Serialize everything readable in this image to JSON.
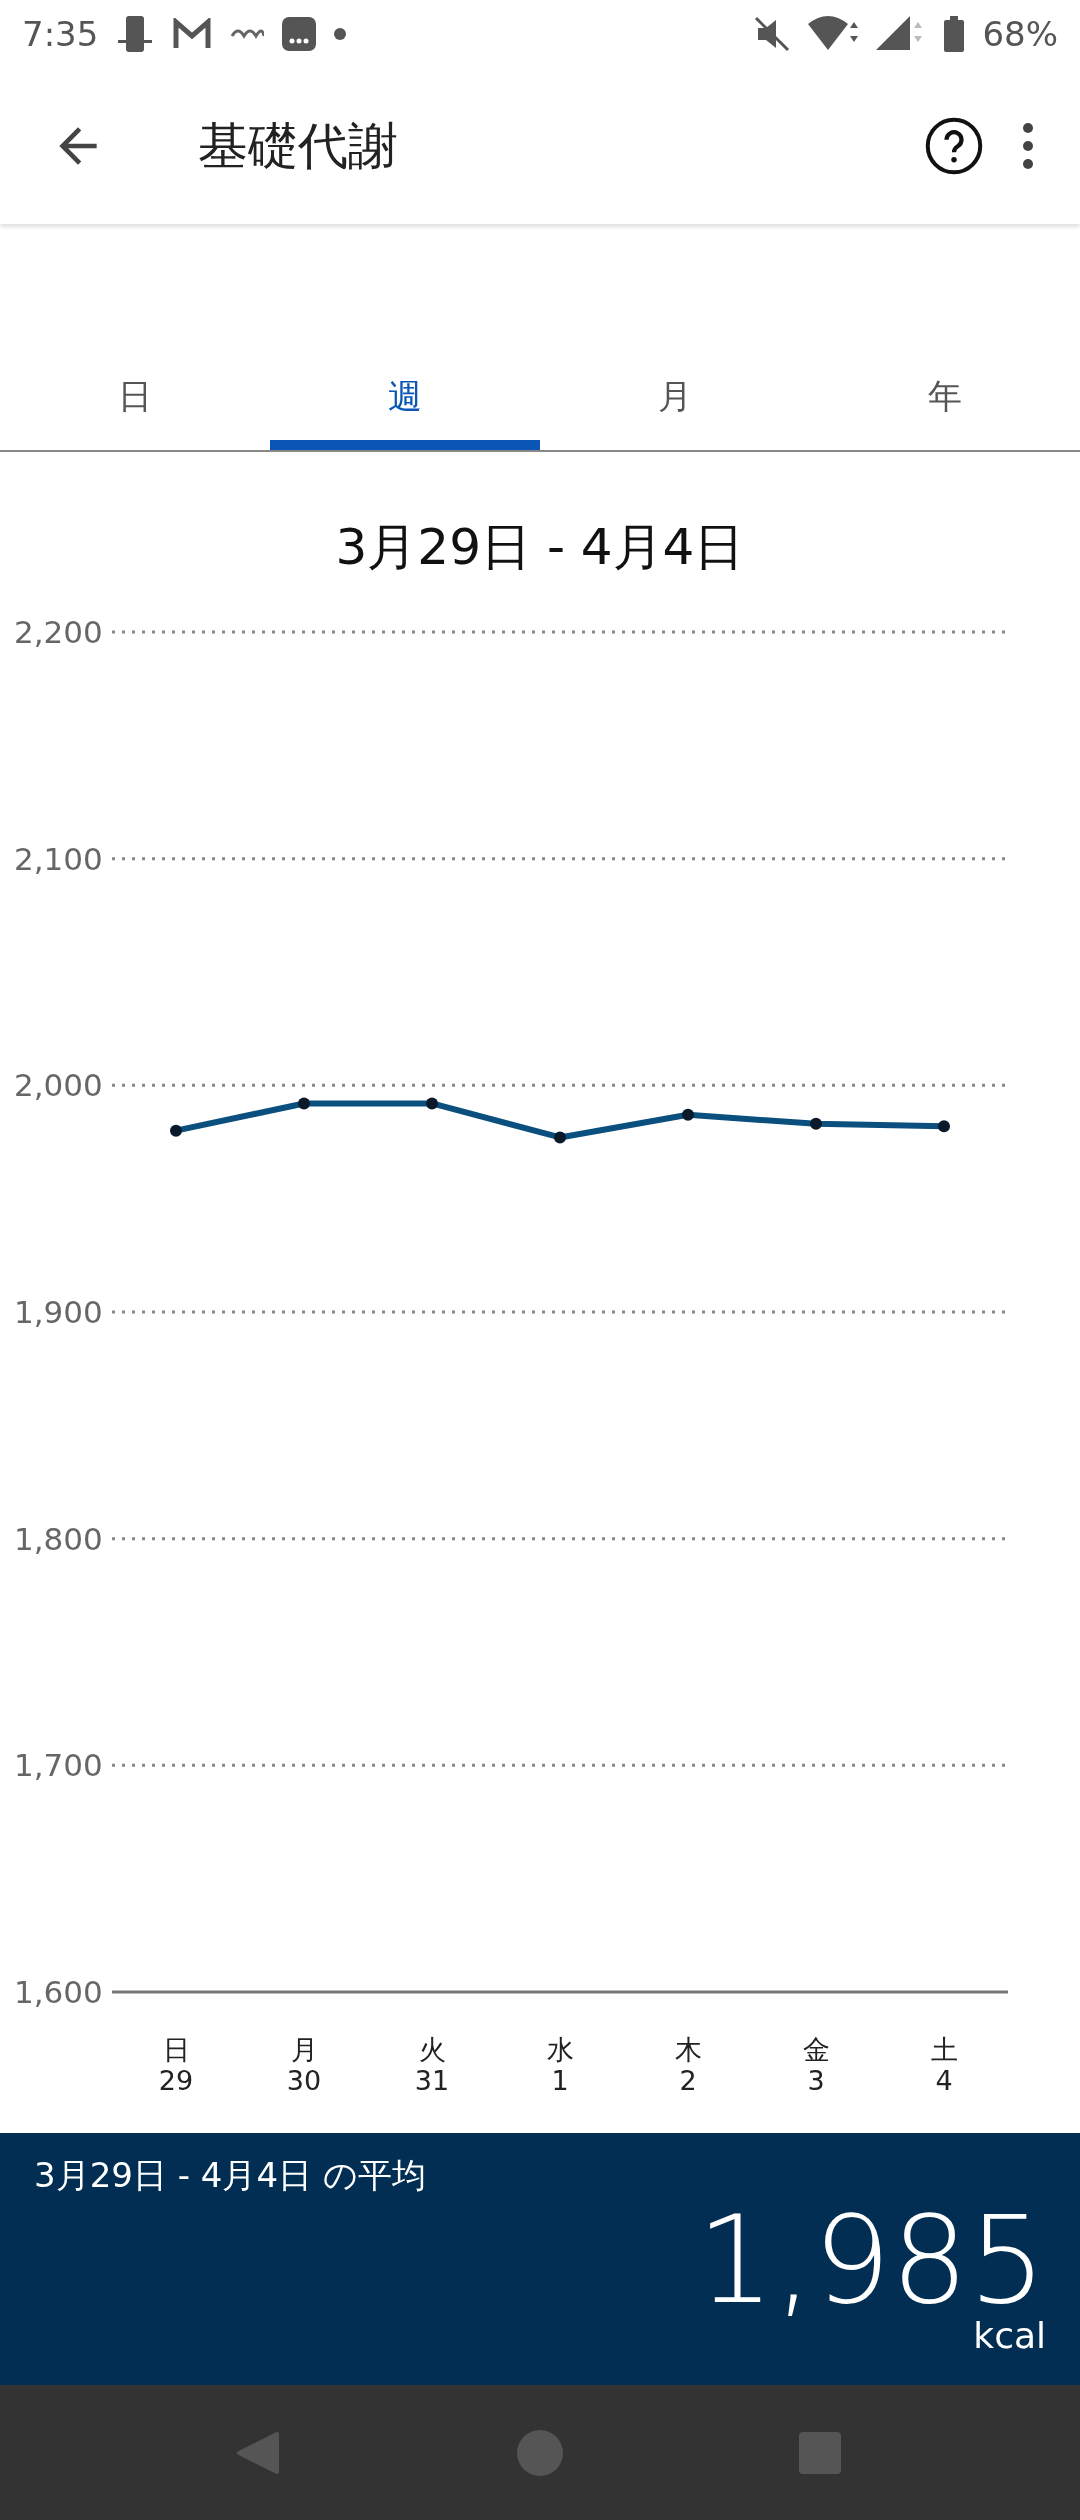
{
  "status_bar": {
    "time": "7:35",
    "battery": "68%"
  },
  "app_bar": {
    "title": "基礎代謝"
  },
  "tabs": [
    {
      "label": "日",
      "selected": false
    },
    {
      "label": "週",
      "selected": true
    },
    {
      "label": "月",
      "selected": false
    },
    {
      "label": "年",
      "selected": false
    }
  ],
  "period_title": "3月29日 - 4月4日",
  "chart_data": {
    "type": "line",
    "categories": [
      "日\n29",
      "月\n30",
      "火\n31",
      "水\n1",
      "木\n2",
      "金\n3",
      "土\n4"
    ],
    "series": [
      {
        "color": "#0a4f7e",
        "marker": true,
        "values": [
          1980,
          1992,
          1992,
          1977,
          1987,
          1983,
          1982
        ]
      }
    ],
    "grid": true,
    "ylim": [
      1600,
      2200
    ],
    "yticks": [
      {
        "value": 2200,
        "label": "2,200"
      },
      {
        "value": 2100,
        "label": "2,100"
      },
      {
        "value": 2000,
        "label": "2,000"
      },
      {
        "value": 1900,
        "label": "1,900"
      },
      {
        "value": 1800,
        "label": "1,800"
      },
      {
        "value": 1700,
        "label": "1,700"
      },
      {
        "value": 1600,
        "label": "1,600"
      }
    ]
  },
  "summary": {
    "label": "3月29日 - 4月4日 の平均",
    "value": "1,985",
    "unit": "kcal"
  }
}
